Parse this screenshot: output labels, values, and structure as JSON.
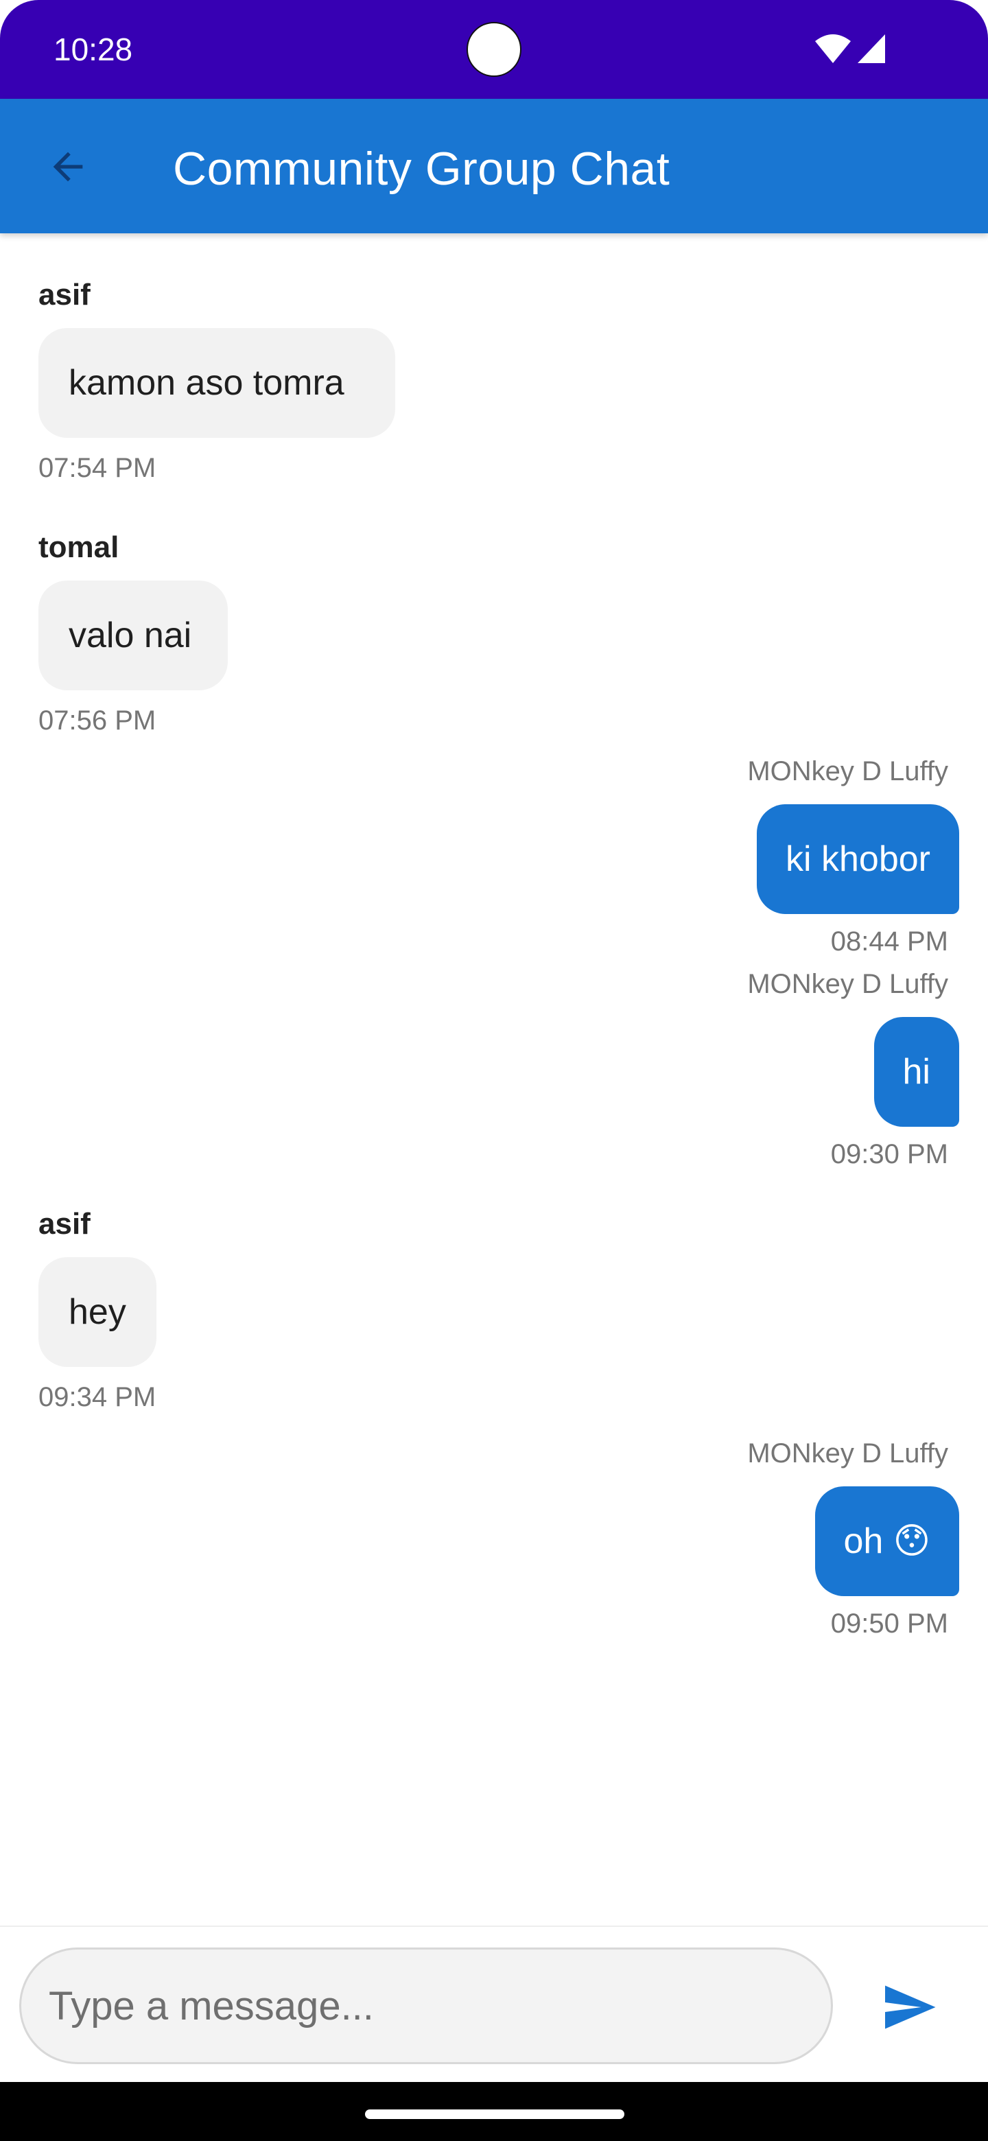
{
  "status_bar": {
    "time": "10:28"
  },
  "app_bar": {
    "title": "Community Group Chat",
    "back_icon": "arrow-back-icon"
  },
  "messages": [
    {
      "sender": "asif",
      "text": "kamon aso tomra",
      "time": "07:54 PM",
      "outgoing": false
    },
    {
      "sender": "tomal",
      "text": "valo nai",
      "time": "07:56 PM",
      "outgoing": false
    },
    {
      "sender": "MONkey D Luffy",
      "text": "ki khobor",
      "time": "08:44 PM",
      "outgoing": true
    },
    {
      "sender": "MONkey D Luffy",
      "text": "hi",
      "time": "09:30 PM",
      "outgoing": true
    },
    {
      "sender": "asif",
      "text": "hey",
      "time": "09:34 PM",
      "outgoing": false
    },
    {
      "sender": "MONkey D Luffy",
      "text": "oh 😯",
      "time": "09:50 PM",
      "outgoing": true
    }
  ],
  "composer": {
    "placeholder": "Type a message...",
    "value": "",
    "send_icon": "send-icon"
  },
  "colors": {
    "status_bar": "#3700b3",
    "app_bar": "#1976d2",
    "outgoing_bubble": "#1976d2",
    "incoming_bubble": "#f2f2f2"
  }
}
